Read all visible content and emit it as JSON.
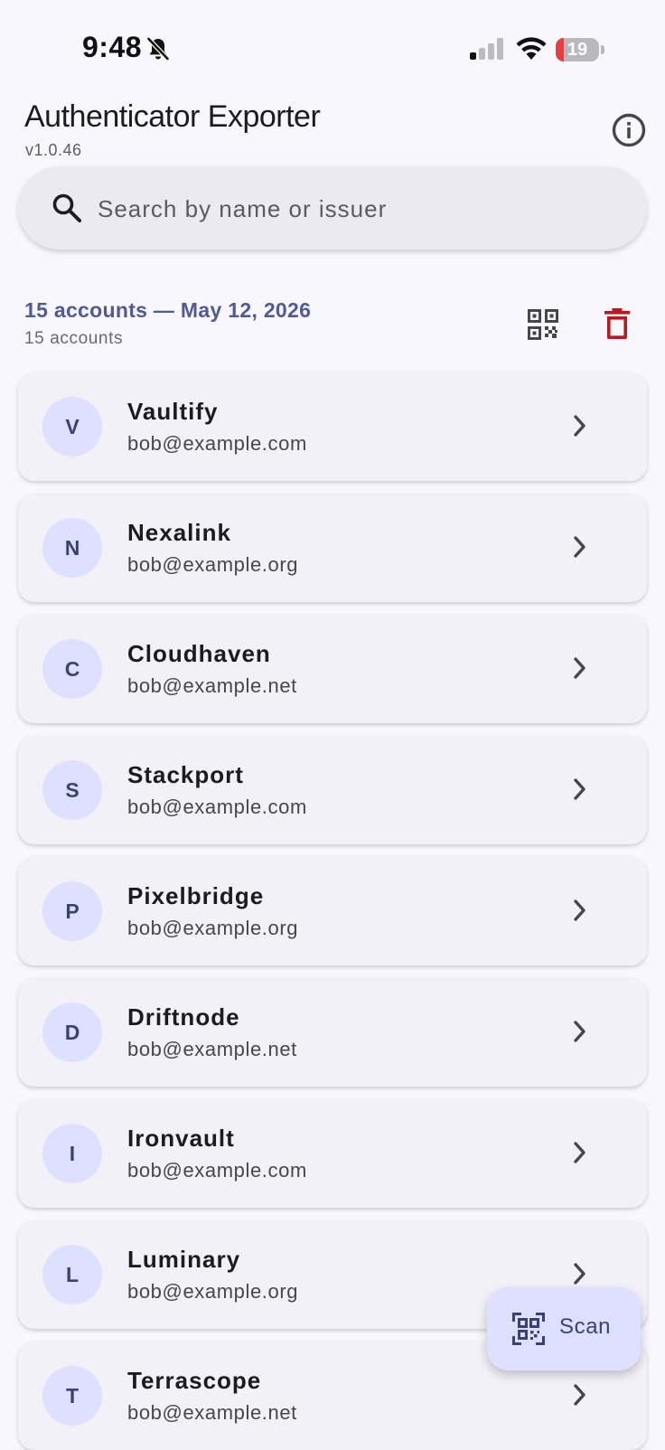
{
  "status_bar": {
    "time": "9:48",
    "battery_level": "19",
    "battery_fraction": 0.19,
    "colors": {
      "battery_low": "#ef3b3b"
    }
  },
  "header": {
    "title": "Authenticator Exporter",
    "version": "v1.0.46",
    "info_icon": "info-icon"
  },
  "search": {
    "placeholder": "Search by name or issuer",
    "value": ""
  },
  "section": {
    "title": "15 accounts — May 12, 2026",
    "subtitle": "15 accounts",
    "actions": [
      "qr-code-icon",
      "delete-icon"
    ],
    "colors": {
      "title": "#4f5b92",
      "delete": "#ba1a1a"
    }
  },
  "accounts": [
    {
      "initial": "V",
      "name": "Vaultify",
      "email": "bob@example.com"
    },
    {
      "initial": "N",
      "name": "Nexalink",
      "email": "bob@example.org"
    },
    {
      "initial": "C",
      "name": "Cloudhaven",
      "email": "bob@example.net"
    },
    {
      "initial": "S",
      "name": "Stackport",
      "email": "bob@example.com"
    },
    {
      "initial": "P",
      "name": "Pixelbridge",
      "email": "bob@example.org"
    },
    {
      "initial": "D",
      "name": "Driftnode",
      "email": "bob@example.net"
    },
    {
      "initial": "I",
      "name": "Ironvault",
      "email": "bob@example.com"
    },
    {
      "initial": "L",
      "name": "Luminary",
      "email": "bob@example.org"
    },
    {
      "initial": "T",
      "name": "Terrascope",
      "email": "bob@example.net"
    }
  ],
  "fab": {
    "label": "Scan",
    "icon": "qr-scan-icon",
    "colors": {
      "background": "#dee0ff",
      "text": "#3b4272"
    }
  }
}
